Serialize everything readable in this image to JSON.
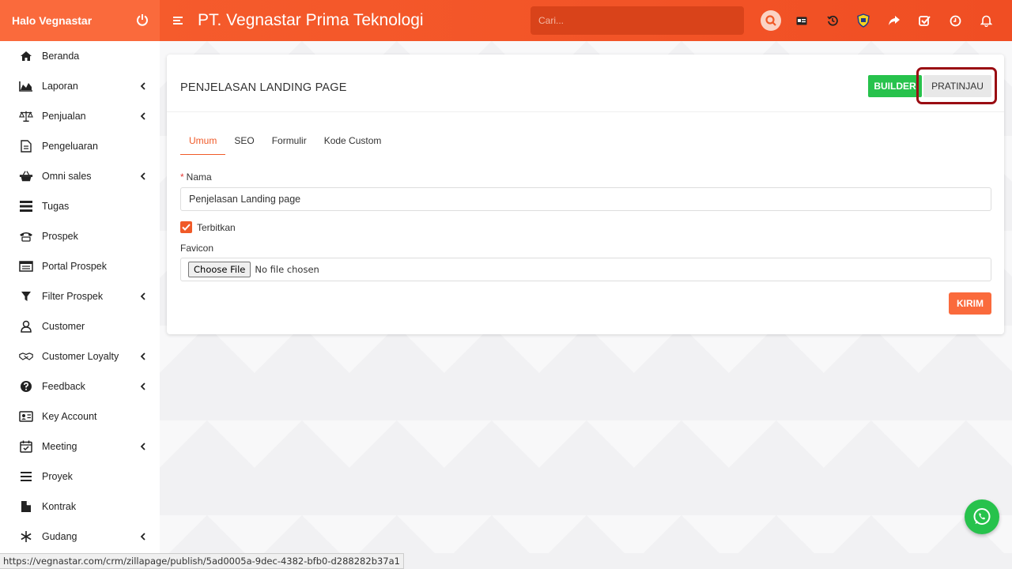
{
  "topbar": {
    "greeting": "Halo Vegnastar",
    "company": "PT. Vegnastar Prima Teknologi",
    "search_placeholder": "Cari...",
    "icons": [
      "search-icon",
      "id-card-icon",
      "history-icon",
      "shield-icon",
      "share-icon",
      "check-square-icon",
      "clock-icon",
      "bell-icon"
    ]
  },
  "sidebar": {
    "items": [
      {
        "label": "Beranda",
        "icon": "home-icon",
        "submenu": false
      },
      {
        "label": "Laporan",
        "icon": "area-chart-icon",
        "submenu": true
      },
      {
        "label": "Penjualan",
        "icon": "scale-icon",
        "submenu": true
      },
      {
        "label": "Pengeluaran",
        "icon": "document-icon",
        "submenu": false
      },
      {
        "label": "Omni sales",
        "icon": "basket-icon",
        "submenu": true
      },
      {
        "label": "Tugas",
        "icon": "tasks-icon",
        "submenu": false
      },
      {
        "label": "Prospek",
        "icon": "phone-icon",
        "submenu": false
      },
      {
        "label": "Portal Prospek",
        "icon": "window-icon",
        "submenu": false
      },
      {
        "label": "Filter Prospek",
        "icon": "filter-icon",
        "submenu": true
      },
      {
        "label": "Customer",
        "icon": "user-icon",
        "submenu": false
      },
      {
        "label": "Customer Loyalty",
        "icon": "handshake-icon",
        "submenu": true
      },
      {
        "label": "Feedback",
        "icon": "question-icon",
        "submenu": true
      },
      {
        "label": "Key Account",
        "icon": "contact-card-icon",
        "submenu": false
      },
      {
        "label": "Meeting",
        "icon": "calendar-check-icon",
        "submenu": true
      },
      {
        "label": "Proyek",
        "icon": "list-icon",
        "submenu": false
      },
      {
        "label": "Kontrak",
        "icon": "file-icon",
        "submenu": false
      },
      {
        "label": "Gudang",
        "icon": "snowflake-icon",
        "submenu": true
      }
    ]
  },
  "card": {
    "title": "PENJELASAN LANDING PAGE",
    "builder_label": "BUILDER",
    "preview_label": "PRATINJAU",
    "tabs": [
      "Umum",
      "SEO",
      "Formulir",
      "Kode Custom"
    ],
    "active_tab": "Umum",
    "name_label": "Nama",
    "required_mark": "*",
    "name_value": "Penjelasan Landing page",
    "publish_label": "Terbitkan",
    "publish_checked": true,
    "favicon_label": "Favicon",
    "choose_file_label": "Choose File",
    "no_file_label": "No file chosen",
    "submit_label": "KIRIM"
  },
  "colors": {
    "brand": "#fa6a3c",
    "builder": "#27c24c",
    "highlight": "#9a0c12"
  },
  "status_url": "https://vegnastar.com/crm/zillapage/publish/5ad0005a-9dec-4382-bfb0-d288282b37a1"
}
